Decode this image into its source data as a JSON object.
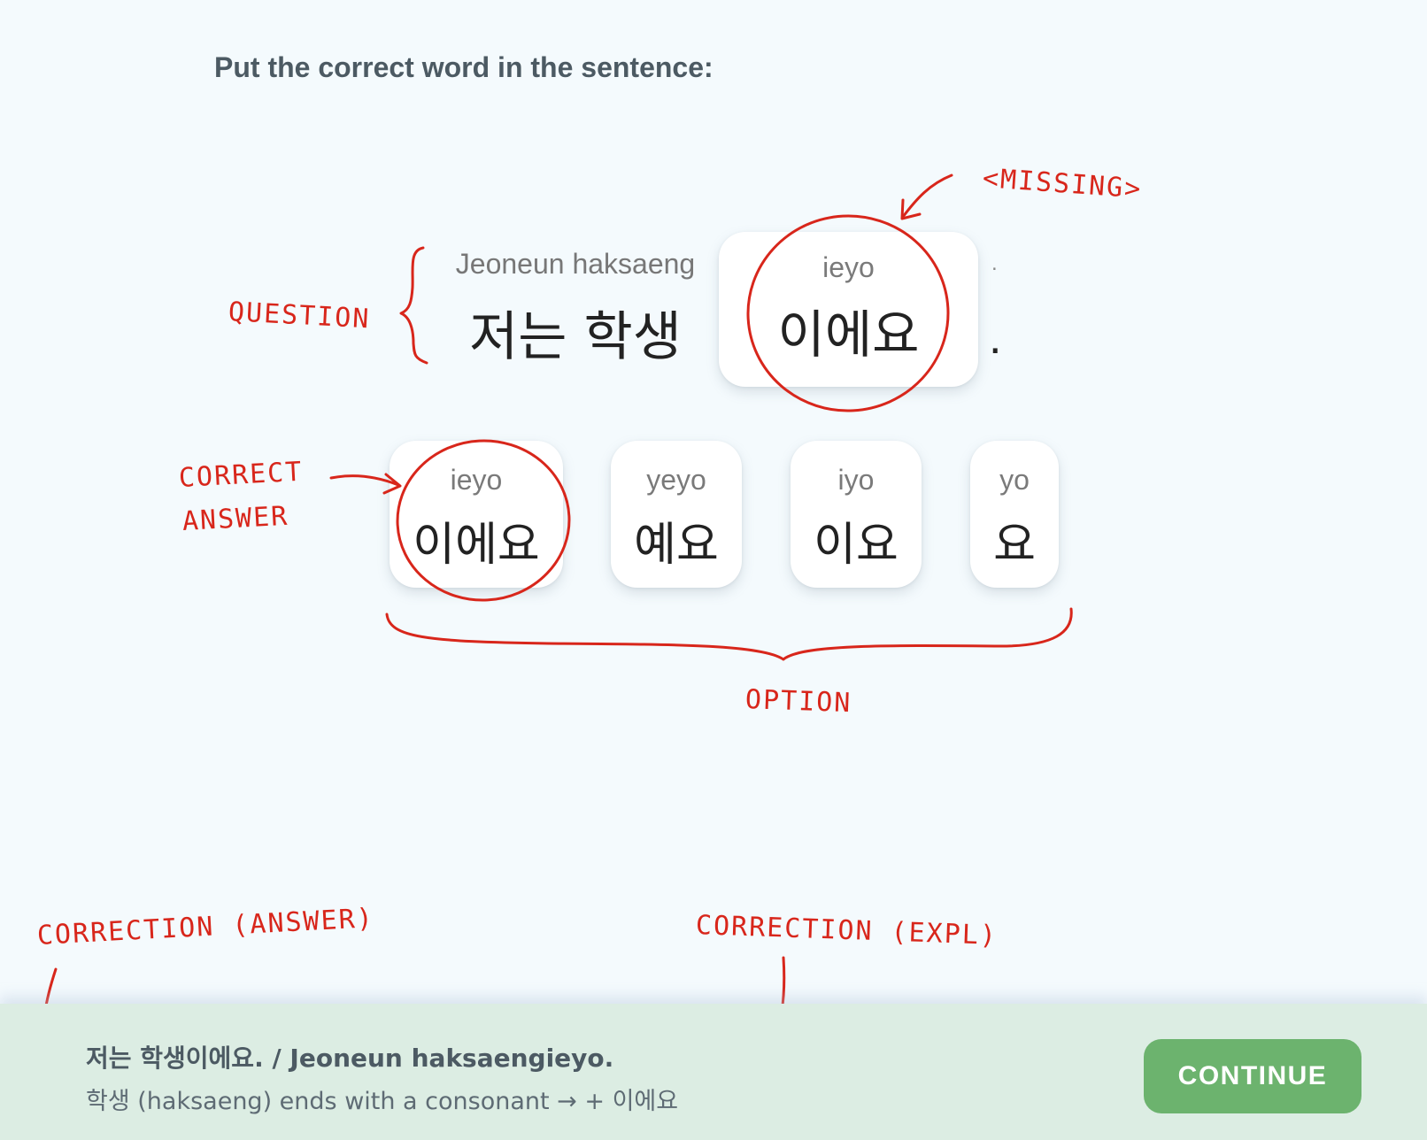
{
  "exercise": {
    "instruction": "Put the correct word in the sentence:"
  },
  "question": {
    "romanization": "Jeoneun haksaeng",
    "korean": "저는 학생",
    "blank": {
      "romanization": "ieyo",
      "korean": "이에요"
    },
    "punctuation_small": ".",
    "punctuation": "."
  },
  "options": [
    {
      "romanization": "ieyo",
      "korean": "이에요"
    },
    {
      "romanization": "yeyo",
      "korean": "예요"
    },
    {
      "romanization": "iyo",
      "korean": "이요"
    },
    {
      "romanization": "yo",
      "korean": "요"
    }
  ],
  "annotations": {
    "missing": "<MISSING>",
    "question": "QUESTION",
    "correct_answer_line1": "CORRECT",
    "correct_answer_line2": "ANSWER",
    "option": "OPTION",
    "correction_answer": "CORRECTION (ANSWER)",
    "correction_expl": "CORRECTION (EXPL)",
    "color": "#d8261b"
  },
  "feedback": {
    "answer": "저는 학생이에요. / Jeoneun haksaengieyo.",
    "explanation": "학생 (haksaeng) ends with a consonant → + 이에요",
    "continue_label": "CONTINUE",
    "bar_color": "#dcede3",
    "button_color": "#6cb36e"
  }
}
